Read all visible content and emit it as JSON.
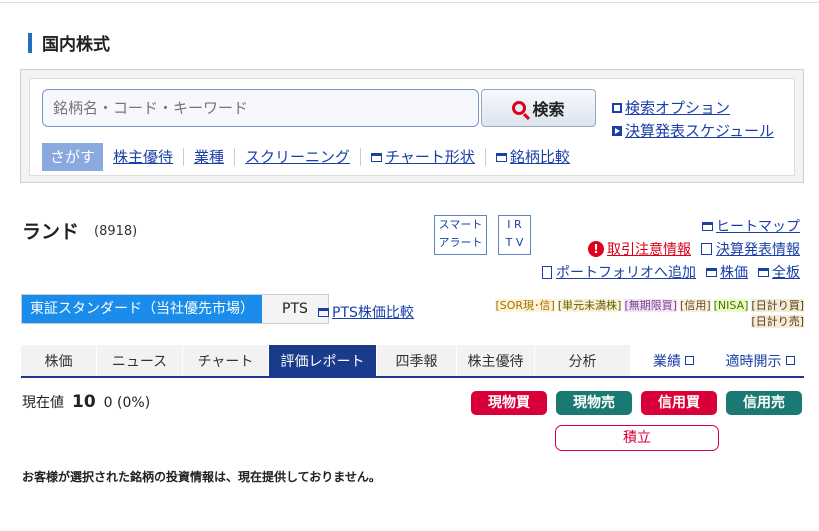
{
  "section_title": "国内株式",
  "search": {
    "placeholder": "銘柄名・コード・キーワード",
    "button_label": "検索",
    "options_link": "検索オプション",
    "schedule_link": "決算発表スケジュール",
    "tabs": [
      {
        "label": "さがす"
      },
      {
        "label": "株主優待"
      },
      {
        "label": "業種"
      },
      {
        "label": "スクリーニング"
      },
      {
        "label": "チャート形状"
      },
      {
        "label": "銘柄比較"
      }
    ]
  },
  "stock": {
    "name": "ランド",
    "code": "(8918)",
    "smart_alert": [
      "スマート",
      "アラート"
    ],
    "ir_tv": [
      "I R",
      "T V"
    ],
    "links": {
      "heatmap": "ヒートマップ",
      "caution": "取引注意情報",
      "earnings": "決算発表情報",
      "portfolio": "ポートフォリオへ追加",
      "price": "株価",
      "board": "全板"
    }
  },
  "market": {
    "active_tab": "東証スタンダード（当社優先市場）",
    "pts_tab": "PTS",
    "pts_compare": "PTS株価比較",
    "badges_line1": [
      "[SOR現･信]",
      "[単元未満株]",
      "[無期限買]",
      "[信用]",
      "[NISA]",
      "[日計り買]"
    ],
    "badges_line2": [
      "[日計り売]"
    ],
    "badge_colors": {
      "sor": "#a36b00",
      "tangen": "#6b5a00",
      "muki": "#7a3c8c",
      "shinyo": "#6b4a1a",
      "nisa": "#3c7a00",
      "hibakari": "#5a3a00"
    }
  },
  "nav_tabs": [
    {
      "label": "株価"
    },
    {
      "label": "ニュース"
    },
    {
      "label": "チャート"
    },
    {
      "label": "評価レポート"
    },
    {
      "label": "四季報"
    },
    {
      "label": "株主優待"
    },
    {
      "label": "分析"
    },
    {
      "label": "業績"
    },
    {
      "label": "適時開示"
    }
  ],
  "price": {
    "label": "現在値",
    "value": "10",
    "change": "0 (0%)"
  },
  "trade": {
    "genbutsu_buy": "現物買",
    "genbutsu_sell": "現物売",
    "shinyo_buy": "信用買",
    "shinyo_sell": "信用売",
    "tsumitate": "積立"
  },
  "notice": "お客様が選択された銘柄の投資情報は、現在提供しておりません。"
}
